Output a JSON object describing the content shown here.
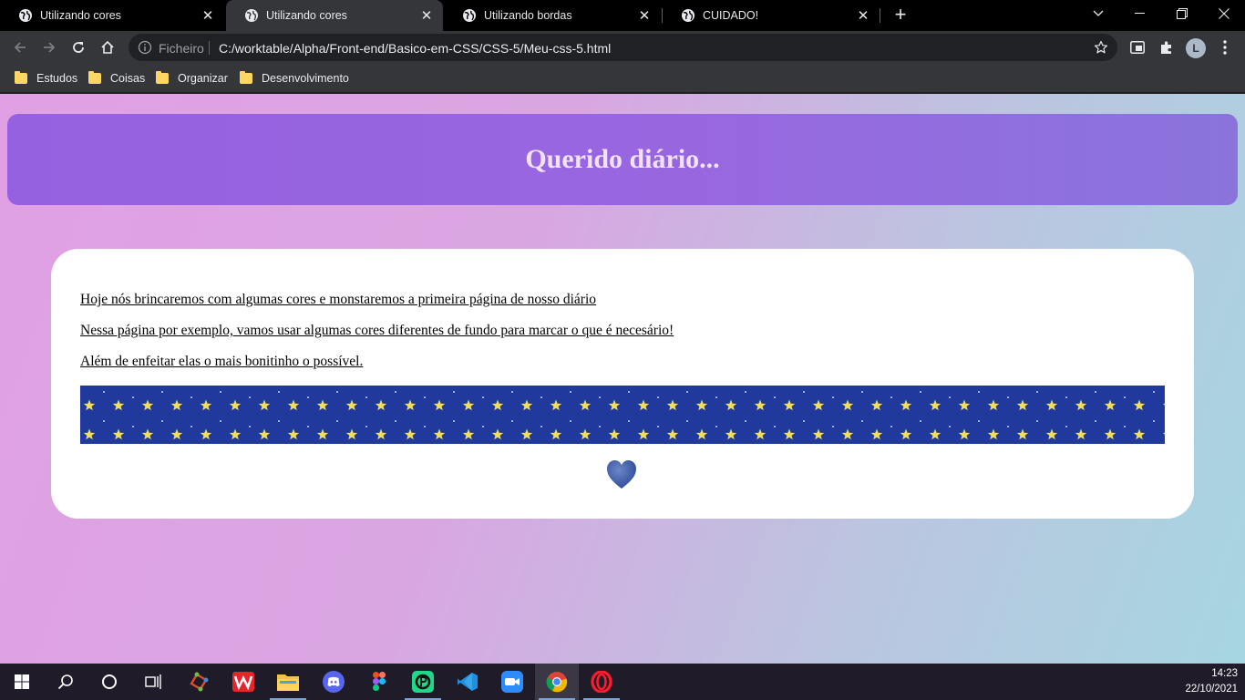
{
  "browser": {
    "tabs": [
      {
        "title": "Utilizando cores",
        "icon": "globe-icon",
        "active": false
      },
      {
        "title": "Utilizando cores",
        "icon": "globe-icon",
        "active": true
      },
      {
        "title": "Utilizando bordas",
        "icon": "globe-icon",
        "active": false
      },
      {
        "title": "CUIDADO!",
        "icon": "globe-icon",
        "active": false
      }
    ],
    "new_tab_label": "+",
    "omnibox": {
      "label": "Ficheiro",
      "url": "C:/worktable/Alpha/Front-end/Basico-em-CSS/CSS-5/Meu-css-5.html"
    },
    "profile_initial": "L",
    "bookmarks": [
      "Estudos",
      "Coisas",
      "Organizar",
      "Desenvolvimento"
    ]
  },
  "page": {
    "heading": "Querido diário...",
    "paragraphs": [
      "Hoje nós brincaremos com algumas cores e monstaremos a primeira página de nosso diário",
      "Nessa página por exemplo, vamos usar algumas cores diferentes de fundo para marcar o que é necesário!",
      "Além de enfeitar elas o mais bonitinho o possível."
    ],
    "colors": {
      "hero_bg": "#9661e0",
      "hero_text": "#f1e2fa",
      "stars_bg": "#1f3a9c",
      "star": "#f2e05a",
      "heart": "#3f5aa8"
    }
  },
  "taskbar": {
    "apps": [
      "windows-start-icon",
      "search-icon",
      "cortana-icon",
      "task-view-icon",
      "git-icon",
      "wps-icon",
      "file-explorer-icon",
      "discord-icon",
      "figma-icon",
      "pycharm-icon",
      "vscode-icon",
      "zoom-icon",
      "chrome-icon",
      "opera-icon"
    ],
    "time": "14:23",
    "date": "22/10/2021"
  }
}
